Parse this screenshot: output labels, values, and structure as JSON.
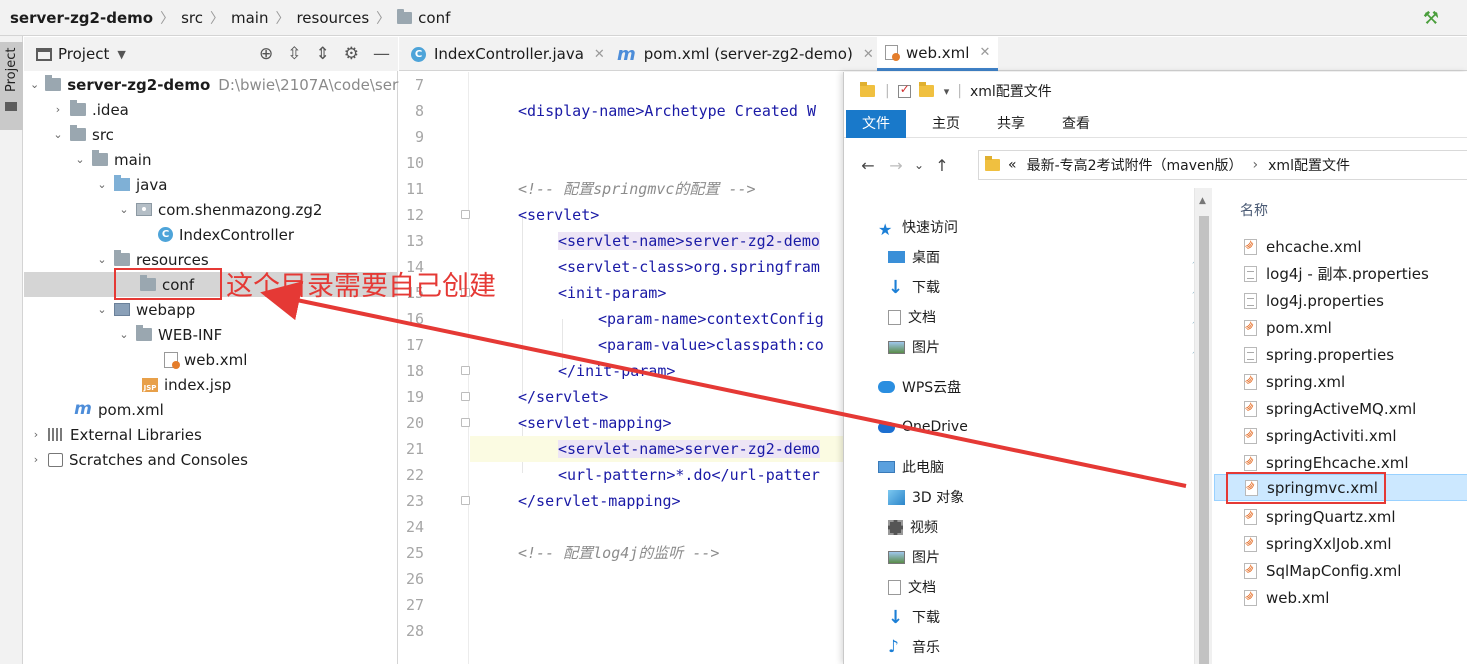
{
  "breadcrumb": {
    "items": [
      "server-zg2-demo",
      "src",
      "main",
      "resources",
      "conf"
    ]
  },
  "tool_window": {
    "label": "Project"
  },
  "project_panel": {
    "title": "Project",
    "tree": [
      {
        "label": "server-zg2-demo",
        "path": "D:\\bwie\\2107A\\code\\serv"
      },
      {
        "label": ".idea"
      },
      {
        "label": "src"
      },
      {
        "label": "main"
      },
      {
        "label": "java"
      },
      {
        "label": "com.shenmazong.zg2"
      },
      {
        "label": "IndexController"
      },
      {
        "label": "resources"
      },
      {
        "label": "conf"
      },
      {
        "label": "webapp"
      },
      {
        "label": "WEB-INF"
      },
      {
        "label": "web.xml"
      },
      {
        "label": "index.jsp"
      },
      {
        "label": "pom.xml"
      },
      {
        "label": "External Libraries"
      },
      {
        "label": "Scratches and Consoles"
      }
    ]
  },
  "editor": {
    "tabs": [
      {
        "label": "IndexController.java"
      },
      {
        "label": "pom.xml (server-zg2-demo)"
      },
      {
        "label": "web.xml"
      }
    ],
    "line_numbers": [
      "7",
      "8",
      "9",
      "10",
      "11",
      "12",
      "13",
      "14",
      "15",
      "16",
      "17",
      "18",
      "19",
      "20",
      "21",
      "22",
      "23",
      "24",
      "25",
      "26",
      "27",
      "28"
    ],
    "lines": {
      "l8": "<display-name>Archetype Created W",
      "l11": "<!-- 配置springmvc的配置 -->",
      "l12": "<servlet>",
      "l13": "<servlet-name>server-zg2-demo",
      "l14": "<servlet-class>org.springfram",
      "l15": "<init-param>",
      "l16": "<param-name>contextConfig",
      "l17": "<param-value>classpath:co",
      "l18": "</init-param>",
      "l19": "</servlet>",
      "l20": "<servlet-mapping>",
      "l21": "<servlet-name>server-zg2-demo",
      "l22": "<url-pattern>*.do</url-patter",
      "l23": "</servlet-mapping>",
      "l25": "<!-- 配置log4j的监听 -->"
    }
  },
  "explorer": {
    "title": "xml配置文件",
    "ribbon": [
      "文件",
      "主页",
      "共享",
      "查看"
    ],
    "address": {
      "prefix": "«",
      "parent": "最新-专高2考试附件（maven版）",
      "current": "xml配置文件"
    },
    "nav": [
      "快速访问",
      "桌面",
      "下载",
      "文档",
      "图片",
      "WPS云盘",
      "OneDrive",
      "此电脑",
      "3D 对象",
      "视频",
      "图片",
      "文档",
      "下载",
      "音乐"
    ],
    "column_header": "名称",
    "files": [
      {
        "name": "ehcache.xml",
        "type": "xml"
      },
      {
        "name": "log4j - 副本.properties",
        "type": "properties"
      },
      {
        "name": "log4j.properties",
        "type": "properties"
      },
      {
        "name": "pom.xml",
        "type": "xml"
      },
      {
        "name": "spring.properties",
        "type": "properties"
      },
      {
        "name": "spring.xml",
        "type": "xml"
      },
      {
        "name": "springActiveMQ.xml",
        "type": "xml"
      },
      {
        "name": "springActiviti.xml",
        "type": "xml"
      },
      {
        "name": "springEhcache.xml",
        "type": "xml"
      },
      {
        "name": "springmvc.xml",
        "type": "xml"
      },
      {
        "name": "springQuartz.xml",
        "type": "xml"
      },
      {
        "name": "springXxlJob.xml",
        "type": "xml"
      },
      {
        "name": "SqlMapConfig.xml",
        "type": "xml"
      },
      {
        "name": "web.xml",
        "type": "xml"
      }
    ]
  },
  "annotation": {
    "text": "这个目录需要自己创建",
    "color": "#e53935"
  },
  "colors": {
    "accent_tab": "#4083c9",
    "ribbon_active": "#1979ca",
    "selected_file": "#cce8ff",
    "xml_tag": "#1a1aa6"
  }
}
